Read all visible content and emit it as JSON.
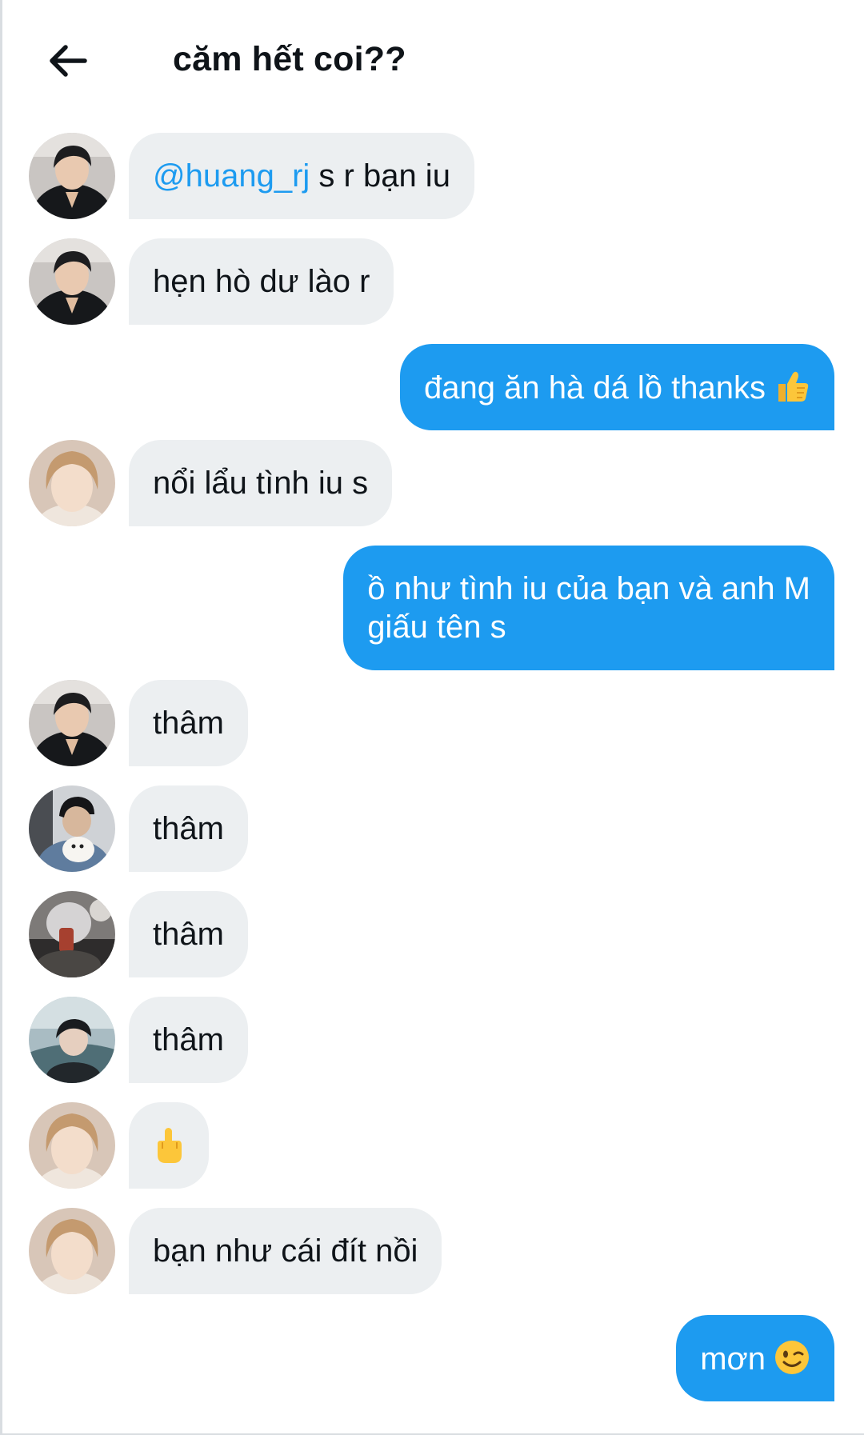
{
  "header": {
    "back_icon": "arrow-left-icon",
    "title": "căm hết coi??"
  },
  "colors": {
    "accent": "#1d9bf0",
    "incoming_bubble": "#eceff1",
    "text": "#0f1419"
  },
  "messages": [
    {
      "direction": "in",
      "avatar": "avatar-user-1",
      "mention": "@huang_rj",
      "text": " s r bạn iu"
    },
    {
      "direction": "in",
      "avatar": "avatar-user-1",
      "text": "hẹn hò dư lào r"
    },
    {
      "direction": "out",
      "text": "đang ăn hà dá lồ thanks",
      "emoji": "thumbs-up-icon"
    },
    {
      "direction": "in",
      "avatar": "avatar-user-2",
      "text": "nổi lẩu tình iu s"
    },
    {
      "direction": "out",
      "line1": "ồ như tình iu của bạn và anh M",
      "line2": "giấu tên s"
    },
    {
      "direction": "in",
      "avatar": "avatar-user-1",
      "text": "thâm"
    },
    {
      "direction": "in",
      "avatar": "avatar-user-3",
      "text": "thâm"
    },
    {
      "direction": "in",
      "avatar": "avatar-user-4",
      "text": "thâm"
    },
    {
      "direction": "in",
      "avatar": "avatar-user-5",
      "text": "thâm"
    },
    {
      "direction": "in",
      "avatar": "avatar-user-2",
      "emoji": "middle-finger-icon"
    },
    {
      "direction": "in",
      "avatar": "avatar-user-2",
      "text": "bạn như cái đít nồi"
    },
    {
      "direction": "out",
      "text": "mơn",
      "emoji": "winking-face-icon"
    }
  ]
}
